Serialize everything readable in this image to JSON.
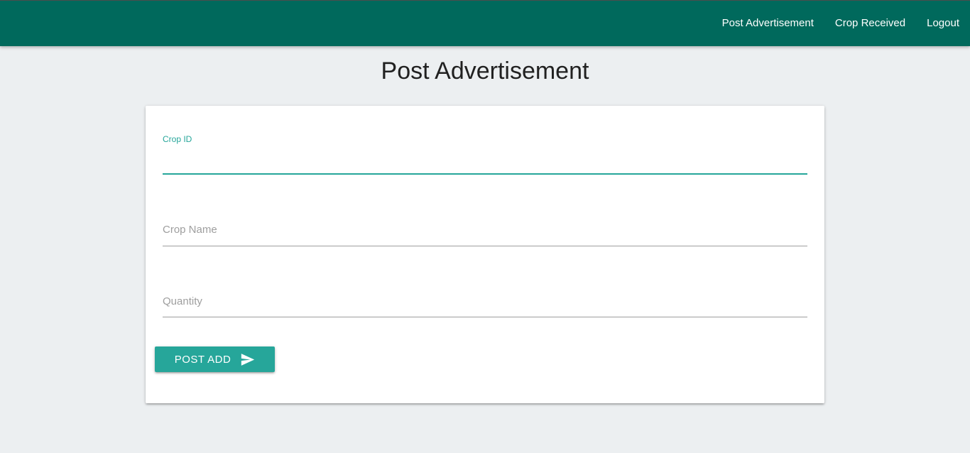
{
  "nav": {
    "links": [
      "Post Advertisement",
      "Crop Received",
      "Logout"
    ]
  },
  "page": {
    "title": "Post Advertisement"
  },
  "form": {
    "crop_id": {
      "label": "Crop ID",
      "value": ""
    },
    "crop_name": {
      "label": "Crop Name",
      "value": ""
    },
    "quantity": {
      "label": "Quantity",
      "value": ""
    },
    "submit_label": "POST ADD",
    "submit_icon": "send-icon"
  },
  "colors": {
    "navbar": "#00695c",
    "accent": "#26a69a",
    "background": "#eceff1"
  }
}
